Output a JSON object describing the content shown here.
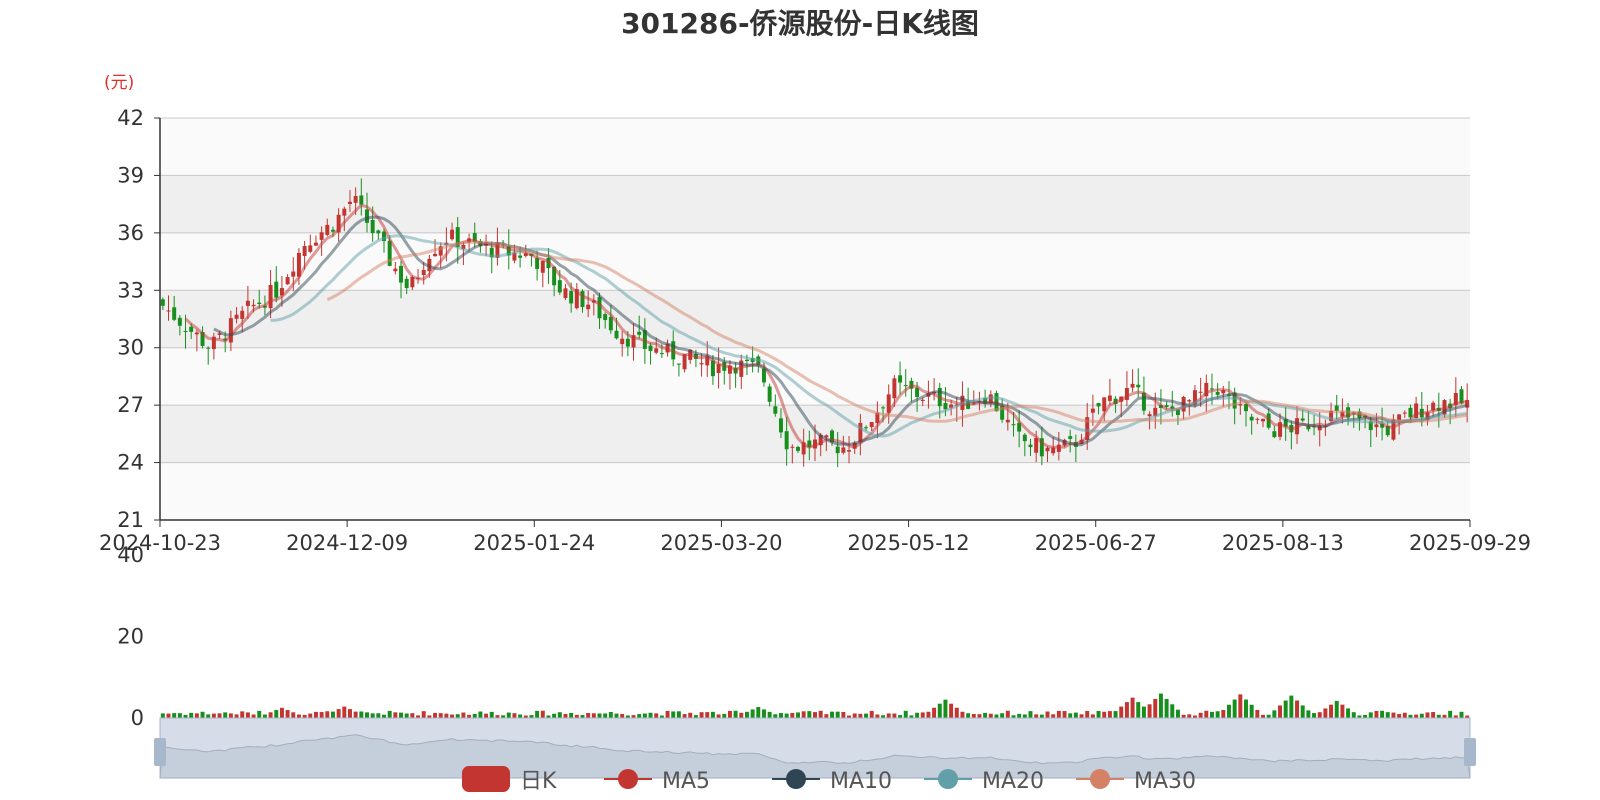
{
  "title": "301286-侨源股份-日K线图",
  "unit_label": "(元)",
  "colors": {
    "up": "#c23531",
    "down": "#178f1d",
    "ma5": "#c23531",
    "ma10": "#2f4554",
    "ma20": "#61a0a8",
    "ma30": "#d48265",
    "grid_band": "#efefef",
    "grid_line": "#c8c8c8",
    "axis": "#333333",
    "slider_fill": "#d6dde9",
    "slider_handle": "#a7b7cc"
  },
  "legend": [
    {
      "name": "日K",
      "color": "#c23531",
      "kind": "box"
    },
    {
      "name": "MA5",
      "color": "#c23531",
      "kind": "line"
    },
    {
      "name": "MA10",
      "color": "#2f4554",
      "kind": "line"
    },
    {
      "name": "MA20",
      "color": "#61a0a8",
      "kind": "line"
    },
    {
      "name": "MA30",
      "color": "#d48265",
      "kind": "line"
    }
  ],
  "chart_data": {
    "type": "candlestick",
    "title": "301286-侨源股份-日K线图",
    "y_unit": "(元)",
    "price_axis": {
      "min": 21,
      "max": 42,
      "ticks": [
        21,
        24,
        27,
        30,
        33,
        36,
        39,
        42
      ]
    },
    "volume_axis": {
      "min": 0,
      "max": 40,
      "ticks": [
        0,
        20,
        40
      ]
    },
    "x_tick_labels": [
      "2024-10-23",
      "2024-12-09",
      "2025-01-24",
      "2025-03-20",
      "2025-05-12",
      "2025-06-27",
      "2025-08-13",
      "2025-09-29"
    ],
    "trading_days": 231,
    "close_keypoints": [
      [
        0,
        32.2
      ],
      [
        10,
        30.0
      ],
      [
        18,
        32.0
      ],
      [
        24,
        33.0
      ],
      [
        30,
        35.5
      ],
      [
        36,
        36.5
      ],
      [
        40,
        37.8
      ],
      [
        44,
        36.2
      ],
      [
        48,
        34.5
      ],
      [
        52,
        33.0
      ],
      [
        56,
        35.0
      ],
      [
        60,
        35.8
      ],
      [
        66,
        35.3
      ],
      [
        72,
        35.0
      ],
      [
        78,
        34.8
      ],
      [
        84,
        33.0
      ],
      [
        90,
        32.3
      ],
      [
        96,
        30.8
      ],
      [
        102,
        30.0
      ],
      [
        110,
        29.5
      ],
      [
        116,
        29.0
      ],
      [
        120,
        29.2
      ],
      [
        126,
        28.8
      ],
      [
        132,
        24.8
      ],
      [
        138,
        25.0
      ],
      [
        144,
        24.8
      ],
      [
        150,
        26.5
      ],
      [
        154,
        28.0
      ],
      [
        160,
        27.5
      ],
      [
        168,
        27.0
      ],
      [
        174,
        27.6
      ],
      [
        180,
        25.3
      ],
      [
        186,
        24.6
      ],
      [
        192,
        24.9
      ],
      [
        198,
        27.2
      ],
      [
        204,
        27.8
      ],
      [
        210,
        26.5
      ],
      [
        216,
        27.1
      ],
      [
        222,
        28.0
      ],
      [
        228,
        26.4
      ],
      [
        234,
        25.7
      ],
      [
        240,
        25.9
      ],
      [
        246,
        26.5
      ],
      [
        252,
        26.2
      ],
      [
        258,
        25.7
      ],
      [
        264,
        26.7
      ],
      [
        270,
        27.2
      ],
      [
        275,
        27.1
      ]
    ],
    "volume_spikes": [
      [
        25,
        2.5
      ],
      [
        38,
        2.8
      ],
      [
        126,
        2.7
      ],
      [
        165,
        4.5
      ],
      [
        205,
        5.0
      ],
      [
        211,
        6.0
      ],
      [
        227,
        5.8
      ],
      [
        238,
        5.5
      ],
      [
        248,
        4.2
      ]
    ],
    "series": [
      {
        "name": "日K"
      },
      {
        "name": "MA5",
        "window": 5
      },
      {
        "name": "MA10",
        "window": 10
      },
      {
        "name": "MA20",
        "window": 20
      },
      {
        "name": "MA30",
        "window": 30
      }
    ],
    "grid": true,
    "legend_position": "bottom-center",
    "datazoom": "slider-bottom"
  }
}
